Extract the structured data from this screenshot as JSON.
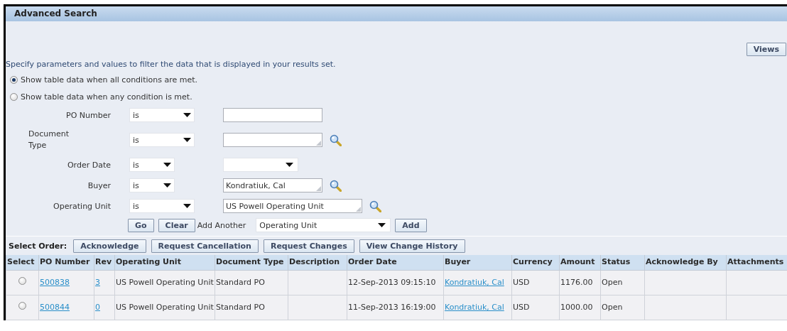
{
  "header": {
    "title": "Advanced Search"
  },
  "views_button": "Views",
  "instructions": "Specify parameters and values to filter the data that is displayed in your results set.",
  "match_options": [
    {
      "label": "Show table data when all conditions are met.",
      "selected": true
    },
    {
      "label": "Show table data when any condition is met.",
      "selected": false
    }
  ],
  "criteria": [
    {
      "label": "PO Number",
      "operator": "is",
      "kind": "text"
    },
    {
      "label": "Document Type",
      "operator": "is",
      "kind": "lov"
    },
    {
      "label": "Order Date",
      "operator": "is",
      "kind": "select"
    },
    {
      "label": "Buyer",
      "operator": "is",
      "kind": "lov",
      "value": "Kondratiuk, Cal"
    },
    {
      "label": "Operating Unit",
      "operator": "is",
      "kind": "lov",
      "value": "US Powell Operating Unit"
    }
  ],
  "search_buttons": [
    "Go",
    "Clear"
  ],
  "add_another": {
    "label": "Add Another",
    "value": "Operating Unit",
    "button": "Add"
  },
  "toolbar": {
    "label": "Select Order:",
    "buttons": [
      "Acknowledge",
      "Request Cancellation",
      "Request Changes",
      "View Change History"
    ]
  },
  "table": {
    "columns": [
      {
        "label": "Select",
        "kind": "radio"
      },
      {
        "label": "PO Number",
        "kind": "link"
      },
      {
        "label": "Rev",
        "kind": "link"
      },
      {
        "label": "Operating Unit",
        "kind": "text"
      },
      {
        "label": "Document Type",
        "kind": "text"
      },
      {
        "label": "Description",
        "kind": "text"
      },
      {
        "label": "Order Date",
        "kind": "text"
      },
      {
        "label": "Buyer",
        "kind": "link"
      },
      {
        "label": "Currency",
        "kind": "text"
      },
      {
        "label": "Amount",
        "kind": "text"
      },
      {
        "label": "Status",
        "kind": "text"
      },
      {
        "label": "Acknowledge By",
        "kind": "text"
      },
      {
        "label": "Attachments",
        "kind": "text"
      }
    ],
    "rows": [
      {
        "selected": false,
        "cells": [
          "",
          "500838",
          "3",
          "US Powell Operating Unit",
          "Standard PO",
          "",
          "12-Sep-2013 09:15:10",
          "Kondratiuk, Cal",
          "USD",
          "1176.00",
          "Open",
          "",
          ""
        ]
      },
      {
        "selected": false,
        "cells": [
          "",
          "500844",
          "0",
          "US Powell Operating Unit",
          "Standard PO",
          "",
          "11-Sep-2013 16:19:00",
          "Kondratiuk, Cal",
          "USD",
          "1000.00",
          "Open",
          "",
          ""
        ]
      }
    ]
  }
}
